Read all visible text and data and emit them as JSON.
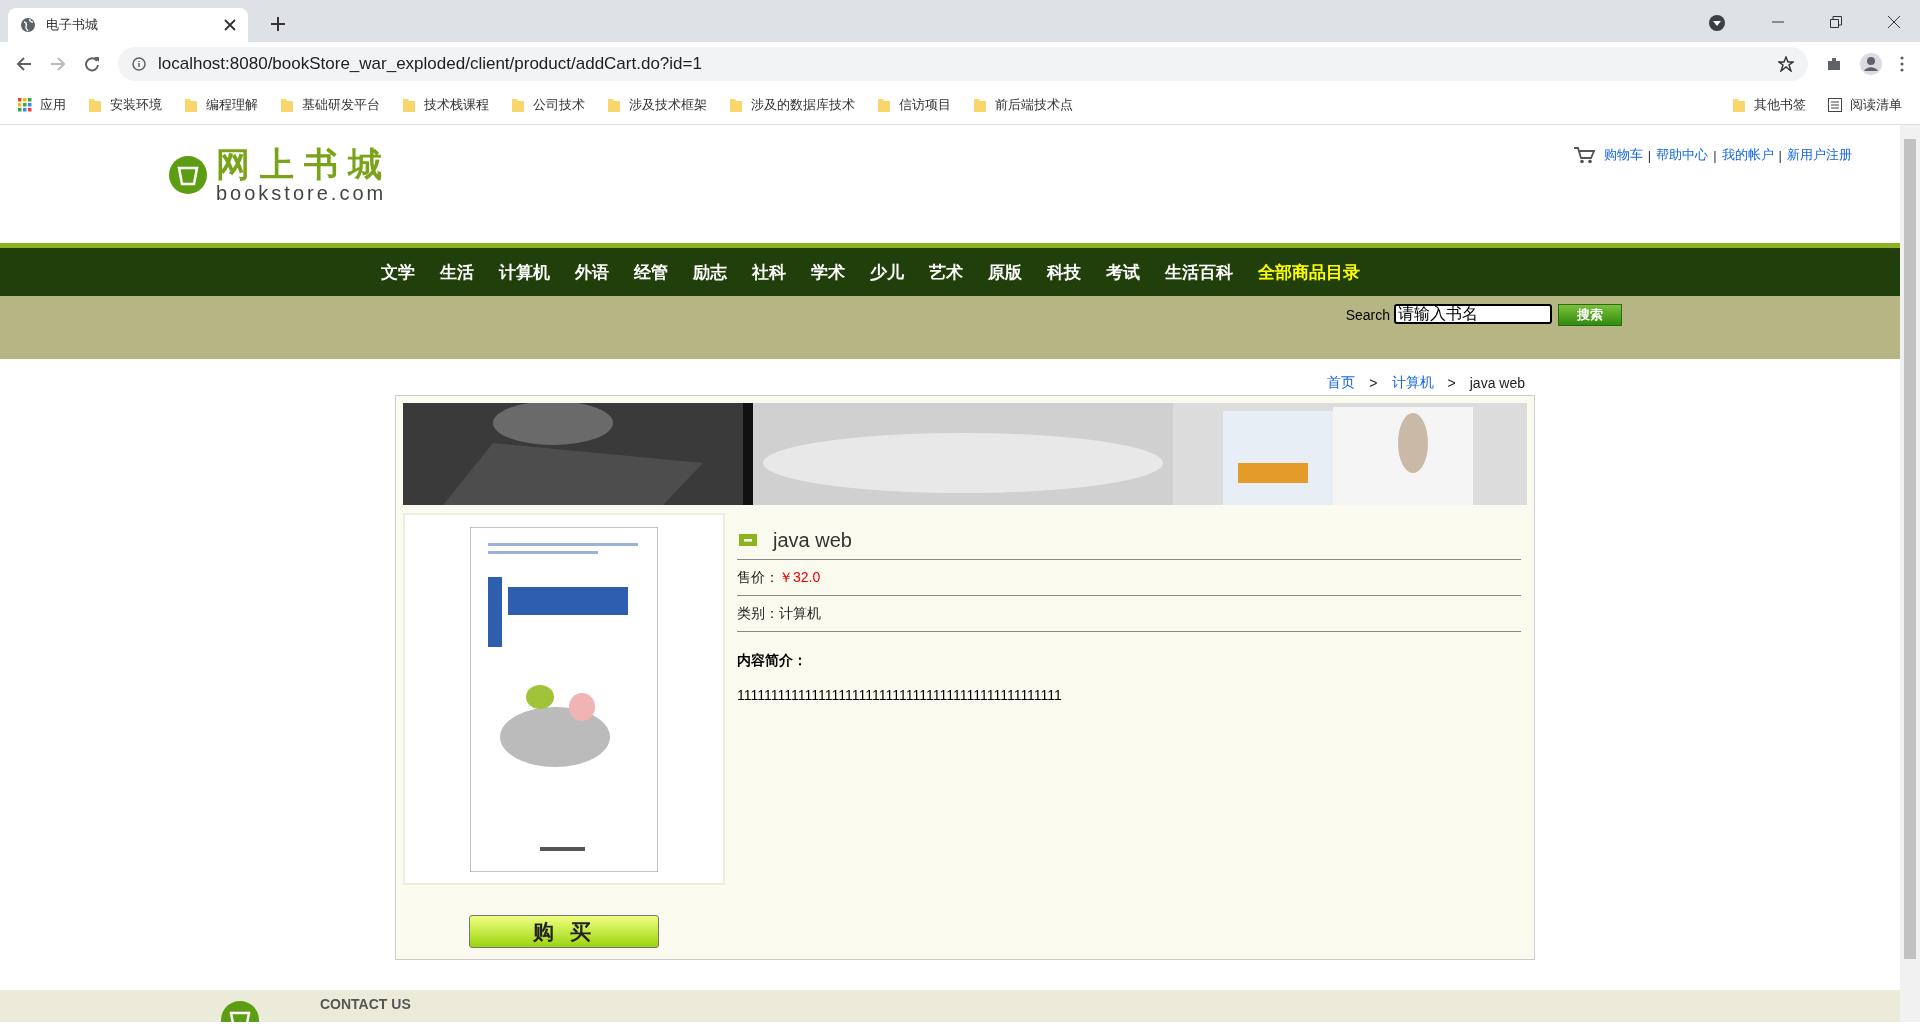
{
  "browser": {
    "tab_title": "电子书城",
    "url": "localhost:8080/bookStore_war_exploded/client/product/addCart.do?id=1",
    "bookmarks": [
      {
        "label": "应用",
        "kind": "apps"
      },
      {
        "label": "安装环境",
        "kind": "folder"
      },
      {
        "label": "编程理解",
        "kind": "folder"
      },
      {
        "label": "基础研发平台",
        "kind": "folder"
      },
      {
        "label": "技术栈课程",
        "kind": "folder"
      },
      {
        "label": "公司技术",
        "kind": "folder"
      },
      {
        "label": "涉及技术框架",
        "kind": "folder"
      },
      {
        "label": "涉及的数据库技术",
        "kind": "folder"
      },
      {
        "label": "信访项目",
        "kind": "folder"
      },
      {
        "label": "前后端技术点",
        "kind": "folder"
      }
    ],
    "other_bookmarks": "其他书签",
    "reading_list": "阅读清单"
  },
  "header": {
    "logo_title": "网上书城",
    "logo_subtitle": "bookstore.com",
    "links": [
      "购物车",
      "帮助中心",
      "我的帐户",
      "新用户注册"
    ],
    "link_separator": "|"
  },
  "nav": [
    {
      "label": "文学",
      "highlight": false
    },
    {
      "label": "生活",
      "highlight": false
    },
    {
      "label": "计算机",
      "highlight": false
    },
    {
      "label": "外语",
      "highlight": false
    },
    {
      "label": "经管",
      "highlight": false
    },
    {
      "label": "励志",
      "highlight": false
    },
    {
      "label": "社科",
      "highlight": false
    },
    {
      "label": "学术",
      "highlight": false
    },
    {
      "label": "少儿",
      "highlight": false
    },
    {
      "label": "艺术",
      "highlight": false
    },
    {
      "label": "原版",
      "highlight": false
    },
    {
      "label": "科技",
      "highlight": false
    },
    {
      "label": "考试",
      "highlight": false
    },
    {
      "label": "生活百科",
      "highlight": false
    },
    {
      "label": "全部商品目录",
      "highlight": true
    }
  ],
  "search": {
    "label": "Search",
    "value": "请输入书名",
    "button": "搜索"
  },
  "breadcrumb": {
    "separator": ">",
    "items": [
      {
        "label": "首页",
        "link": true
      },
      {
        "label": "计算机",
        "link": true
      },
      {
        "label": "java web",
        "link": false
      }
    ]
  },
  "product": {
    "title": "java web",
    "price_label": "售价：",
    "price": "￥32.0",
    "category_label": "类别：",
    "category": "计算机",
    "intro_label": "内容简介：",
    "intro": "111111111111111111111111111111111111111111111111",
    "buy_button": "购 买"
  },
  "footer": {
    "contact": "CONTACT US"
  }
}
